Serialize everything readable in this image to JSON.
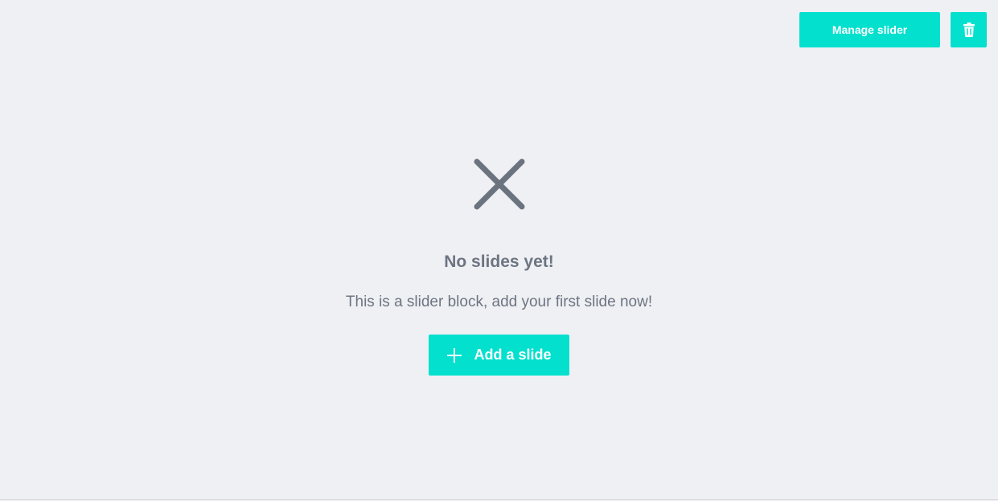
{
  "toolbar": {
    "manage_label": "Manage slider",
    "delete_icon": "trash-icon"
  },
  "empty_state": {
    "icon": "close-icon",
    "title": "No slides yet!",
    "subtitle": "This is a slider block, add your first slide now!",
    "add_button_label": "Add a slide",
    "add_button_icon": "plus-icon"
  },
  "colors": {
    "accent": "#03e0ce",
    "background": "#eff0f4",
    "muted_text": "#6c7581"
  }
}
